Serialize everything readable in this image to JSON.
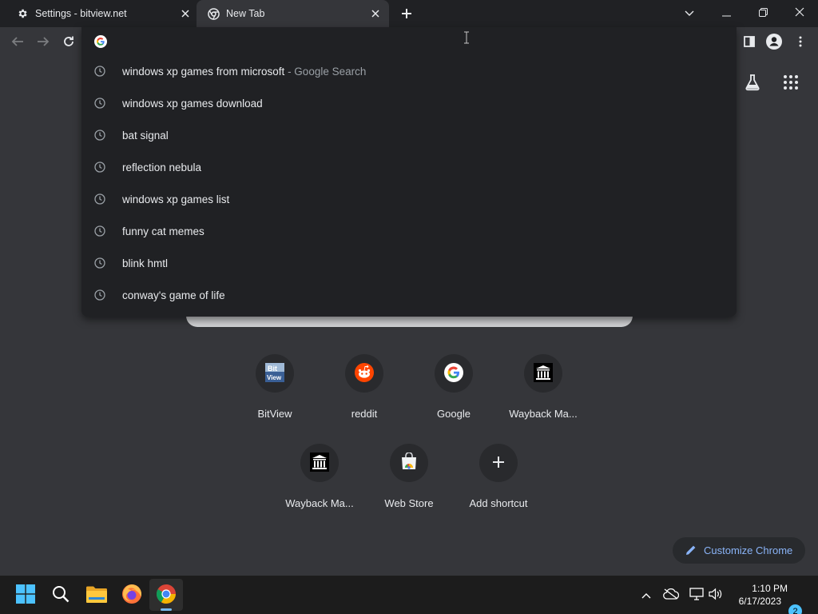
{
  "tabs": [
    {
      "title": "Settings - bitview.net",
      "icon": "gear-icon",
      "active": false
    },
    {
      "title": "New Tab",
      "icon": "chrome-icon",
      "active": true
    }
  ],
  "omnibox": {
    "value": "",
    "placeholder": "",
    "suggestions": [
      {
        "text": "windows xp games from microsoft",
        "suffix": " - Google Search"
      },
      {
        "text": "windows xp games download",
        "suffix": ""
      },
      {
        "text": "bat signal",
        "suffix": ""
      },
      {
        "text": "reflection nebula",
        "suffix": ""
      },
      {
        "text": "windows xp games list",
        "suffix": ""
      },
      {
        "text": "funny cat memes",
        "suffix": ""
      },
      {
        "text": "blink hmtl",
        "suffix": ""
      },
      {
        "text": "conway's game of life",
        "suffix": ""
      }
    ]
  },
  "shortcuts": [
    {
      "label": "BitView",
      "icon": "bitview-logo-icon",
      "logo_text": "Bit View"
    },
    {
      "label": "reddit",
      "icon": "reddit-icon"
    },
    {
      "label": "Google",
      "icon": "google-icon"
    },
    {
      "label": "Wayback Ma...",
      "icon": "wayback-machine-icon"
    },
    {
      "label": "Wayback Ma...",
      "icon": "wayback-machine-icon"
    },
    {
      "label": "Web Store",
      "icon": "web-store-icon"
    },
    {
      "label": "Add shortcut",
      "icon": "plus-icon"
    }
  ],
  "customize": {
    "label": "Customize Chrome"
  },
  "taskbar": {
    "time": "1:10 PM",
    "date": "6/17/2023",
    "notifications": "2"
  },
  "colors": {
    "tab_strip": "#202124",
    "toolbar": "#35363a",
    "accent_link": "#8ab4f8",
    "taskbar": "#1c1c1c",
    "notification_badge": "#4cc2ff"
  }
}
